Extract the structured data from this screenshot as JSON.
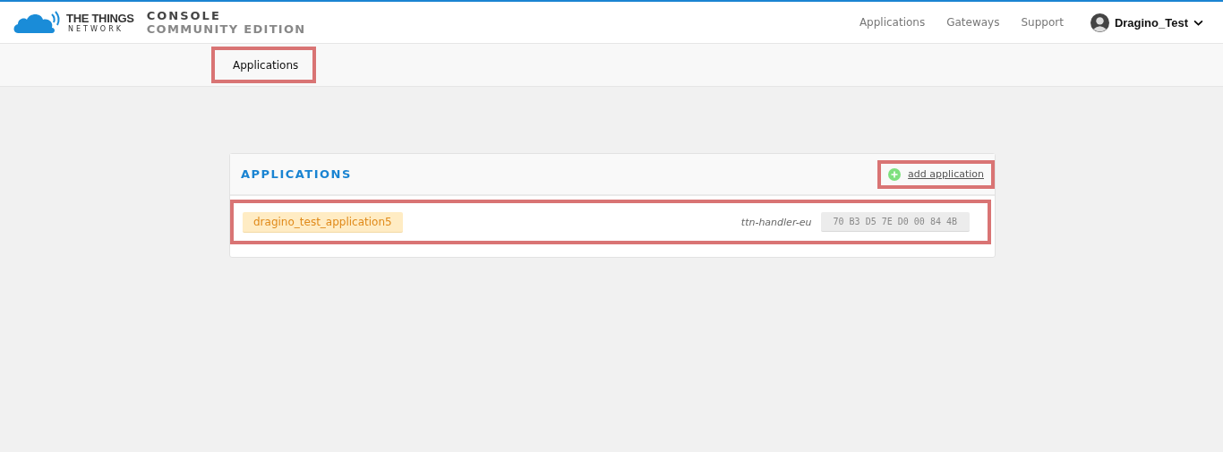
{
  "header": {
    "brand": "THE THINGS",
    "brand_sub": "NETWORK",
    "product": "CONSOLE",
    "edition": "COMMUNITY EDITION",
    "nav": [
      {
        "label": "Applications"
      },
      {
        "label": "Gateways"
      },
      {
        "label": "Support"
      }
    ],
    "user": "Dragino_Test"
  },
  "breadcrumb": {
    "label": "Applications",
    "highlighted": true
  },
  "panel": {
    "title": "APPLICATIONS",
    "add": {
      "label": "add application",
      "highlighted": true
    },
    "rows": [
      {
        "name": "dragino_test_application5",
        "handler": "ttn-handler-eu",
        "eui": "70 B3 D5 7E D0 00 84 4B",
        "highlighted": true
      }
    ]
  }
}
